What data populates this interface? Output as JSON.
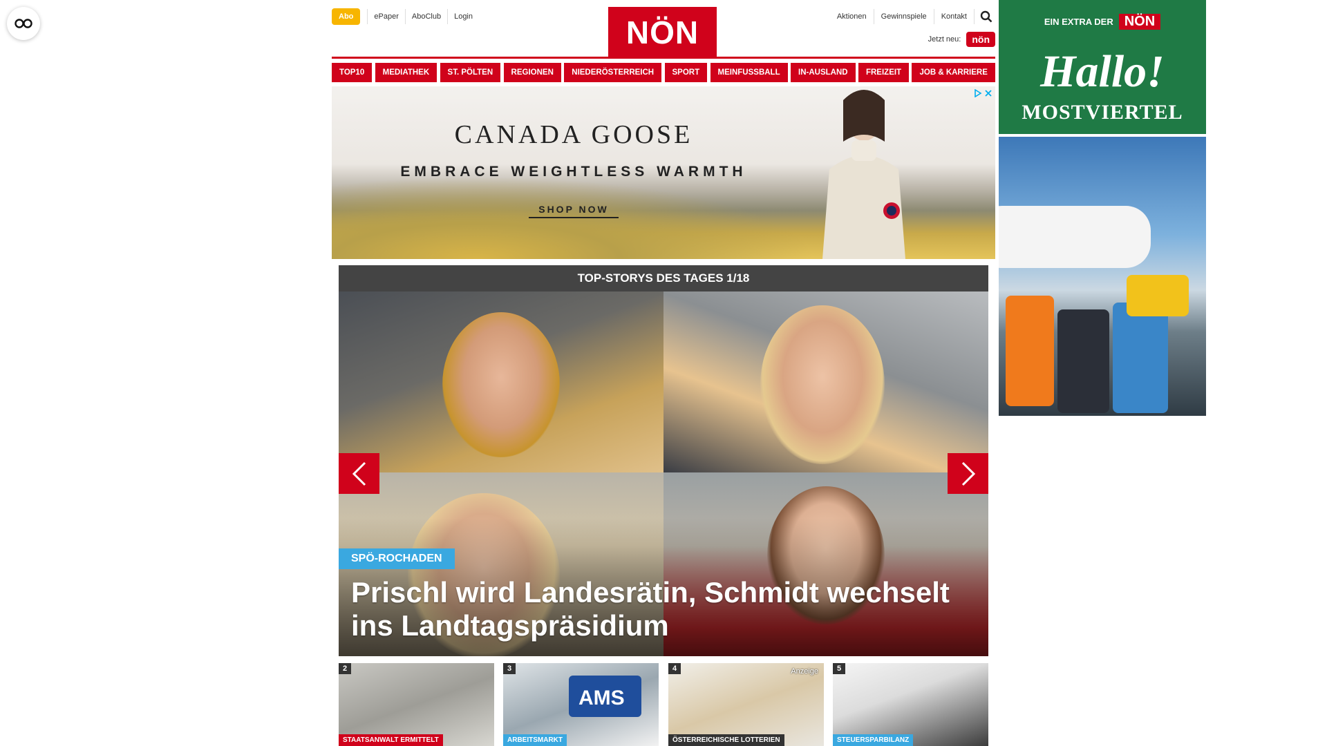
{
  "topbar": {
    "abo_label": "Abo",
    "left_links": [
      "ePaper",
      "AboClub",
      "Login"
    ],
    "logo_text": "NÖN",
    "right_links": [
      "Aktionen",
      "Gewinnspiele",
      "Kontakt"
    ],
    "jetzt_neu_label": "Jetzt neu:",
    "jetzt_neu_badge": "nön"
  },
  "nav": {
    "items": [
      "TOP10",
      "MEDIATHEK",
      "ST. PÖLTEN",
      "REGIONEN",
      "NIEDERÖSTERREICH",
      "SPORT",
      "MEINFUSSBALL",
      "IN-AUSLAND",
      "FREIZEIT",
      "JOB & KARRIERE"
    ]
  },
  "ad_banner": {
    "brand": "CANADA GOOSE",
    "tagline": "EMBRACE WEIGHTLESS WARMTH",
    "cta": "SHOP NOW"
  },
  "slider": {
    "header": "TOP-STORYS DES TAGES 1/18",
    "kicker": "SPÖ-ROCHADEN",
    "headline": "Prischl wird Landesrätin, Schmidt wechselt ins Landtagspräsidium"
  },
  "teasers": [
    {
      "number": "2",
      "tag": "STAATSANWALT ERMITTELT",
      "tag_color": "#d0021b",
      "anzeige": ""
    },
    {
      "number": "3",
      "tag": "ARBEITSMARKT",
      "tag_color": "#3aa8e0",
      "anzeige": ""
    },
    {
      "number": "4",
      "tag": "ÖSTERREICHISCHE LOTTERIEN",
      "tag_color": "#333333",
      "anzeige": "Anzeige"
    },
    {
      "number": "5",
      "tag": "STEUERSPARBILANZ",
      "tag_color": "#3aa8e0",
      "anzeige": ""
    }
  ],
  "side_ad": {
    "top_text": "EIN EXTRA DER",
    "top_logo": "NÖN",
    "title": "Hallo!",
    "subtitle": "MOSTVIERTEL"
  },
  "colors": {
    "brand_red": "#d0021b",
    "abo_yellow": "#f7b500",
    "kicker_blue": "#3aa8e0",
    "side_green": "#1f7a45"
  }
}
